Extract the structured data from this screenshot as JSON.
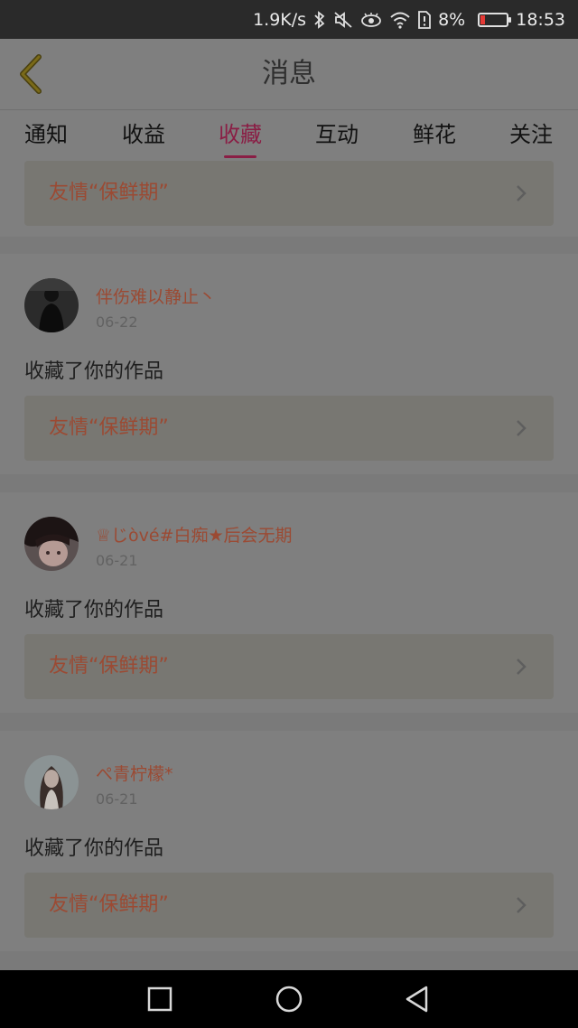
{
  "status_bar": {
    "network_speed": "1.9K/s",
    "battery_percent": "8%",
    "time": "18:53",
    "icons": [
      "bluetooth-icon",
      "mute-icon",
      "eye-comfort-icon",
      "wifi-icon",
      "sim-alert-icon",
      "battery-icon"
    ]
  },
  "header": {
    "title": "消息",
    "back_icon": "chevron-left-icon"
  },
  "tabs": [
    {
      "label": "通知",
      "active": false
    },
    {
      "label": "收益",
      "active": false
    },
    {
      "label": "收藏",
      "active": true
    },
    {
      "label": "互动",
      "active": false
    },
    {
      "label": "鲜花",
      "active": false
    },
    {
      "label": "关注",
      "active": false
    }
  ],
  "feed": {
    "partial_card": {
      "work_title": "友情“保鲜期”"
    },
    "items": [
      {
        "username": "伴伤难以静止丶",
        "date": "06-22",
        "action": "收藏了你的作品",
        "work_title": "友情“保鲜期”"
      },
      {
        "username": "♕じòvé#白痴★后会无期",
        "date": "06-21",
        "action": "收藏了你的作品",
        "work_title": "友情“保鲜期”"
      },
      {
        "username": "ぺ青柠檬*",
        "date": "06-21",
        "action": "收藏了你的作品",
        "work_title": "友情“保鲜期”"
      }
    ]
  },
  "colors": {
    "accent": "#8a1e45",
    "username": "#9b4a33",
    "overlay_background": "#7f7f7f"
  },
  "nav_bar": {
    "icons": [
      "recent-apps-icon",
      "home-icon",
      "back-triangle-icon"
    ]
  }
}
